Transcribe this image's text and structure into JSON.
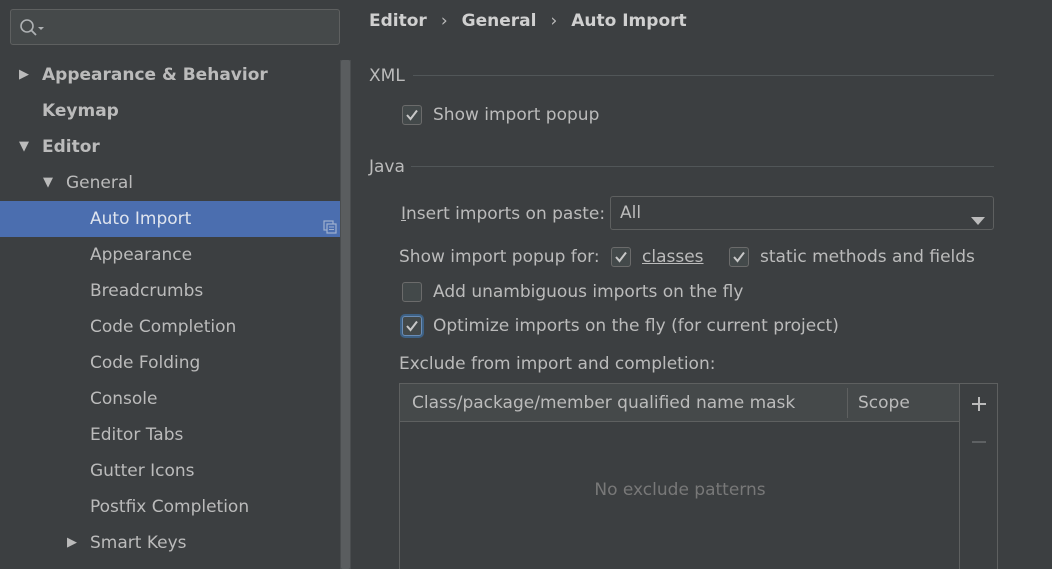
{
  "search": {
    "placeholder": "",
    "value": ""
  },
  "tree": [
    {
      "label": "Appearance & Behavior",
      "bold": true,
      "arrow": "right",
      "level": 0
    },
    {
      "label": "Keymap",
      "bold": true,
      "arrow": "",
      "level": 0
    },
    {
      "label": "Editor",
      "bold": true,
      "arrow": "down",
      "level": 0
    },
    {
      "label": "General",
      "bold": false,
      "arrow": "down",
      "level": 1
    },
    {
      "label": "Auto Import",
      "bold": false,
      "arrow": "",
      "level": 2,
      "selected": true
    },
    {
      "label": "Appearance",
      "bold": false,
      "arrow": "",
      "level": 2
    },
    {
      "label": "Breadcrumbs",
      "bold": false,
      "arrow": "",
      "level": 2
    },
    {
      "label": "Code Completion",
      "bold": false,
      "arrow": "",
      "level": 2
    },
    {
      "label": "Code Folding",
      "bold": false,
      "arrow": "",
      "level": 2
    },
    {
      "label": "Console",
      "bold": false,
      "arrow": "",
      "level": 2
    },
    {
      "label": "Editor Tabs",
      "bold": false,
      "arrow": "",
      "level": 2
    },
    {
      "label": "Gutter Icons",
      "bold": false,
      "arrow": "",
      "level": 2
    },
    {
      "label": "Postfix Completion",
      "bold": false,
      "arrow": "",
      "level": 2
    },
    {
      "label": "Smart Keys",
      "bold": false,
      "arrow": "right",
      "level": 2
    }
  ],
  "breadcrumb": [
    "Editor",
    "General",
    "Auto Import"
  ],
  "xml": {
    "title": "XML",
    "show_import_popup": {
      "label": "Show import popup",
      "checked": true
    }
  },
  "java": {
    "title": "Java",
    "insert_imports_label": "Insert imports on paste:",
    "insert_imports_value": "All",
    "show_popup_for_label": "Show import popup for:",
    "classes": {
      "label": "classes",
      "checked": true
    },
    "static_methods": {
      "label": "static methods and fields",
      "checked": true
    },
    "add_unambiguous": {
      "label": "Add unambiguous imports on the fly",
      "checked": false
    },
    "optimize_imports": {
      "label": "Optimize imports on the fly (for current project)",
      "checked": true
    },
    "exclude_label": "Exclude from import and completion:",
    "table": {
      "columns": [
        "Class/package/member qualified name mask",
        "Scope"
      ],
      "empty_text": "No exclude patterns"
    }
  },
  "colors": {
    "background": "#3c3f41",
    "selection": "#4b6eaf",
    "text": "#bbbbbb"
  }
}
